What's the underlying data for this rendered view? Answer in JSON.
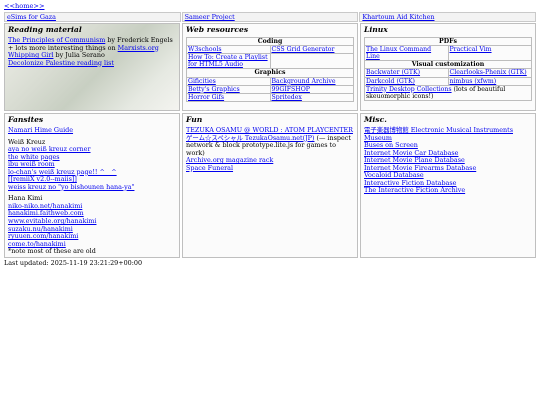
{
  "home_link": "<<home>>",
  "top_links": [
    "eSims for Gaza",
    "Sameer Project",
    "Khartoum Aid Kitchen"
  ],
  "reading": {
    "title": "Reading material",
    "items": [
      {
        "link": "The Principles of Communism",
        "text": " by Frederick Engels"
      },
      {
        "prefix": "+ lots more interesting things on ",
        "link": "Marxists.org",
        "text": ""
      },
      {
        "link": "Whipping Girl",
        "text": " by Julia Serano"
      },
      {
        "link": "Decolonize Palestine reading list",
        "text": ""
      }
    ]
  },
  "web": {
    "title": "Web resources",
    "sections": [
      {
        "heading": "Coding",
        "rows": [
          [
            "W3schools",
            "CSS Grid Generator"
          ],
          [
            "How To: Create a Playlist for HTML5 Audio",
            ""
          ]
        ]
      },
      {
        "heading": "Graphics",
        "rows": [
          [
            "Gificities",
            "Background Archive"
          ],
          [
            "Betty's Graphics",
            "99GIFSHOP"
          ],
          [
            "Horror Gifs",
            "Spritedex"
          ]
        ]
      }
    ]
  },
  "linux": {
    "title": "Linux",
    "pdfs_heading": "PDFs",
    "pdfs": [
      [
        "The Linux Command Line",
        "Practical Vim"
      ]
    ],
    "visual_heading": "Visual customization",
    "visual": [
      [
        "Backwater (GTK)",
        "Clearlooks-Phenix (GTK)"
      ],
      [
        "Darkcold (GTK)",
        "nimbus (xfwm)"
      ]
    ],
    "trinity_link": "Trinity Desktop Collections",
    "trinity_note": " (lots of beautiful skeuomorphic icons!)"
  },
  "fansites": {
    "title": "Fansites",
    "top_link": "Namari Hime Guide",
    "weiss_heading": "Weiß Kreuz",
    "weiss_links": [
      "aya no weiß kreuz corner",
      "the white pages",
      "ibu weiß room",
      "lo-chan's weiß kreuz page!! ^__^",
      "[[remiiX v2.0--maiis]]",
      "weiss kreuz no \"yo bishounen hana-ya\""
    ],
    "hana_heading": "Hana Kimi",
    "hana_links": [
      "niko-niko.net/hanakimi",
      "hanakimi.faithweb.com",
      "www.evitable.org/hanakimi",
      "suzaku.nu/hanakimi",
      "ryuuen.com/hanakimi",
      "come.to/hanakimi"
    ],
    "note": "*note most of these are old"
  },
  "fun": {
    "title": "Fun",
    "items": [
      {
        "link": "TEZUKA OSAMU @ WORLD : ATOM PLAYCENTER",
        "text": ""
      },
      {
        "link": "ゲーム☆スペシャル TezukaOsamu.net(JP)",
        "text": " (— inspect network & block prototype.lite.js for games to work)"
      },
      {
        "link": "Archive.org magazine rack",
        "text": ""
      },
      {
        "link": "Space Funeral",
        "text": ""
      }
    ]
  },
  "misc": {
    "title": "Misc.",
    "links": [
      "電子楽器博物館 Electronic Musical Instruments Museum",
      "Buses on Screen",
      "Internet Movie Car Database",
      "Internet Movie Plane Database",
      "Internet Movie Firearms Database",
      "Vocaloid Database",
      "Interactive Fiction Database",
      "The Interactive Fiction Archive"
    ]
  },
  "footer": {
    "updated": "Last updated: 2025-11-19 23:21:29+00:00"
  }
}
